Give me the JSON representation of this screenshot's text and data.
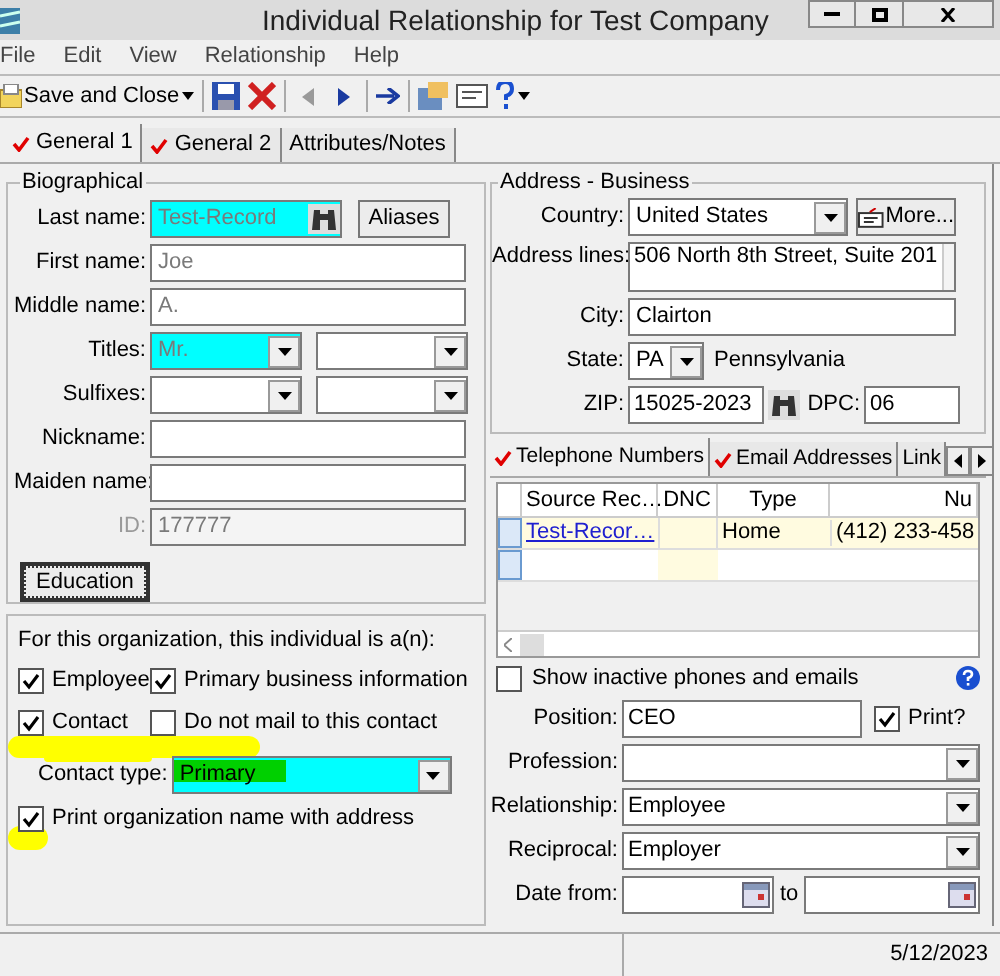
{
  "window": {
    "title": "Individual Relationship for Test Company"
  },
  "menu": [
    "File",
    "Edit",
    "View",
    "Relationship",
    "Help"
  ],
  "toolbar": {
    "save_label": "Save and Close"
  },
  "tabs": [
    {
      "label": "General 1",
      "checked": true,
      "selected": true
    },
    {
      "label": "General 2",
      "checked": true,
      "selected": false
    },
    {
      "label": "Attributes/Notes",
      "checked": false,
      "selected": false
    }
  ],
  "biographical": {
    "title": "Biographical",
    "aliases_button": "Aliases",
    "education_button": "Education",
    "fields": [
      {
        "label": "Last name:",
        "kind": "lookup",
        "value": "Test-Record",
        "color": "#00ffff",
        "disabled": false
      },
      {
        "label": "First name:",
        "kind": "text",
        "value": "Joe",
        "disabled": false
      },
      {
        "label": "Middle name:",
        "kind": "text",
        "value": "A.",
        "disabled": false
      },
      {
        "label": "Titles:",
        "kind": "pair",
        "value": "Mr.",
        "color": "#00ffff",
        "disabled": false
      },
      {
        "label": "Sulfixes:",
        "kind": "pair",
        "disabled": false
      },
      {
        "label": "Nickname:",
        "kind": "text",
        "disabled": false
      },
      {
        "label": "Maiden name:",
        "kind": "text",
        "disabled": false
      },
      {
        "label": "ID:",
        "kind": "text",
        "value": "177777",
        "disabled": true
      }
    ]
  },
  "address": {
    "title": "Address - Business",
    "country_label": "Country:",
    "country": "United States",
    "more_button": "More...",
    "lines_label": "Address lines:",
    "lines": "506 North 8th Street, Suite 201",
    "city_label": "City:",
    "city": "Clairton",
    "state_label": "State:",
    "state": "PA",
    "state_name": "Pennsylvania",
    "zip_label": "ZIP:",
    "zip": "15025-2023",
    "dpc_label": "DPC:",
    "dpc": "06"
  },
  "contact_tabs": [
    {
      "label": "Telephone Numbers",
      "checked": true,
      "selected": true
    },
    {
      "label": "Email Addresses",
      "checked": true,
      "selected": false
    },
    {
      "label": "Link",
      "checked": false,
      "selected": false
    }
  ],
  "phone_table": {
    "columns": [
      "Source Rec…",
      "DNC",
      "Type",
      "Nu"
    ],
    "rows": [
      {
        "source_record": "Test-Recor…",
        "type": "Home",
        "number": "(412) 233-458"
      }
    ]
  },
  "show_inactive": {
    "label": "Show inactive phones and emails",
    "checked": false
  },
  "organization": {
    "title": "For this organization, this individual is a(n):",
    "checks": [
      {
        "label": "Employee",
        "checked": true
      },
      {
        "label": "Primary business information",
        "checked": true
      },
      {
        "label": "Contact",
        "checked": true
      },
      {
        "label": "Do not mail to this contact",
        "checked": false
      }
    ],
    "contact_type_label": "Contact type:",
    "contact_type": "Primary",
    "print_name": {
      "label": "Print organization name with address",
      "checked": true
    }
  },
  "details": {
    "position_label": "Position:",
    "position": "CEO",
    "print": {
      "label": "Print?",
      "checked": true
    },
    "profession_label": "Profession:",
    "relationship_label": "Relationship:",
    "relationship": "Employee",
    "reciprocal_label": "Reciprocal:",
    "reciprocal": "Employer",
    "date_from_label": "Date from:",
    "date_to_label": "to"
  },
  "status_bar": {
    "date": "5/12/2023"
  }
}
